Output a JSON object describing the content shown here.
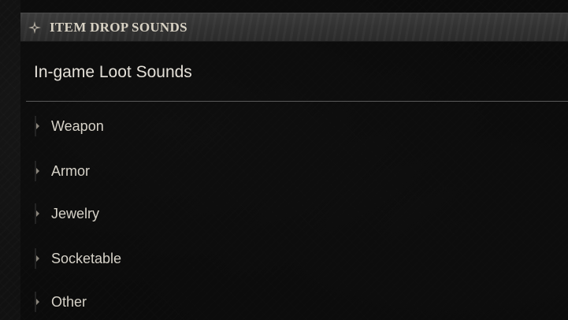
{
  "header": {
    "title": "ITEM DROP SOUNDS",
    "icon": "four-point-star-icon"
  },
  "section": {
    "title": "In-game Loot Sounds"
  },
  "categories": [
    {
      "label": "Weapon",
      "icon": "expand-arrow-icon"
    },
    {
      "label": "Armor",
      "icon": "expand-arrow-icon"
    },
    {
      "label": "Jewelry",
      "icon": "expand-arrow-icon"
    },
    {
      "label": "Socketable",
      "icon": "expand-arrow-icon"
    },
    {
      "label": "Other",
      "icon": "expand-arrow-icon"
    }
  ],
  "colors": {
    "background": "#111111",
    "header_bar": "#353535",
    "header_text": "#d8d2c4",
    "text": "#d6d2c8",
    "divider": "#5a5a5a"
  }
}
